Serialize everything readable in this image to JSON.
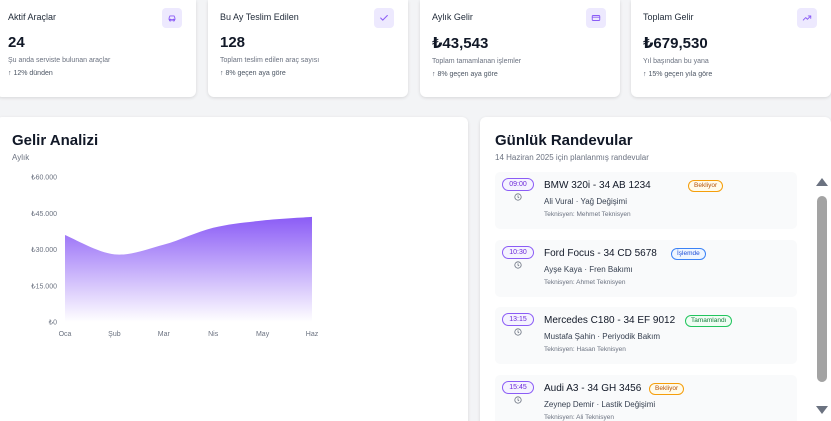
{
  "stats": [
    {
      "label": "Aktif Araçlar",
      "value": "24",
      "sub": "Şu anda serviste bulunan araçlar",
      "trend": "↑ 12% dünden",
      "icon": "car-icon"
    },
    {
      "label": "Bu Ay Teslim Edilen",
      "value": "128",
      "sub": "Toplam teslim edilen araç sayısı",
      "trend": "↑ 8% geçen aya göre",
      "icon": "check-icon"
    },
    {
      "label": "Aylık Gelir",
      "value": "₺43,543",
      "sub": "Toplam tamamlanan işlemler",
      "trend": "↑ 8% geçen aya göre",
      "icon": "credit-card-icon"
    },
    {
      "label": "Toplam Gelir",
      "value": "₺679,530",
      "sub": "Yıl başından bu yana",
      "trend": "↑ 15% geçen yıla göre",
      "icon": "trending-up-icon"
    }
  ],
  "revenue": {
    "title": "Gelir Analizi",
    "subtitle": "Aylık"
  },
  "chart_data": {
    "type": "area",
    "categories": [
      "Oca",
      "Şub",
      "Mar",
      "Nis",
      "May",
      "Haz"
    ],
    "values": [
      36000,
      28000,
      32000,
      39000,
      42000,
      43500
    ],
    "ylim": [
      0,
      60000
    ],
    "yticks": [
      "₺0",
      "₺15.000",
      "₺30.000",
      "₺45.000",
      "₺60.000"
    ],
    "grid": false,
    "fill_top": "#8b5cf6",
    "fill_bottom": "#ffffff"
  },
  "appointments": {
    "title": "Günlük Randevular",
    "subtitle": "14 Haziran 2025 için planlanmış randevular",
    "items": [
      {
        "time": "09:00",
        "vehicle": "BMW 320i - 34 AB 1234",
        "status": "Bekliyor",
        "status_kind": "wait",
        "customer": "Ali Vural · Yağ Değişimi",
        "tech": "Teknisyen: Mehmet Teknisyen"
      },
      {
        "time": "10:30",
        "vehicle": "Ford Focus - 34 CD 5678",
        "status": "İşlemde",
        "status_kind": "proc",
        "customer": "Ayşe Kaya · Fren Bakımı",
        "tech": "Teknisyen: Ahmet Teknisyen"
      },
      {
        "time": "13:15",
        "vehicle": "Mercedes C180 - 34 EF 9012",
        "status": "Tamamlandı",
        "status_kind": "done",
        "customer": "Mustafa Şahin · Periyodik Bakım",
        "tech": "Teknisyen: Hasan Teknisyen"
      },
      {
        "time": "15:45",
        "vehicle": "Audi A3 - 34 GH 3456",
        "status": "Bekliyor",
        "status_kind": "wait",
        "customer": "Zeynep Demir · Lastik Değişimi",
        "tech": "Teknisyen: Ali Teknisyen"
      }
    ]
  }
}
